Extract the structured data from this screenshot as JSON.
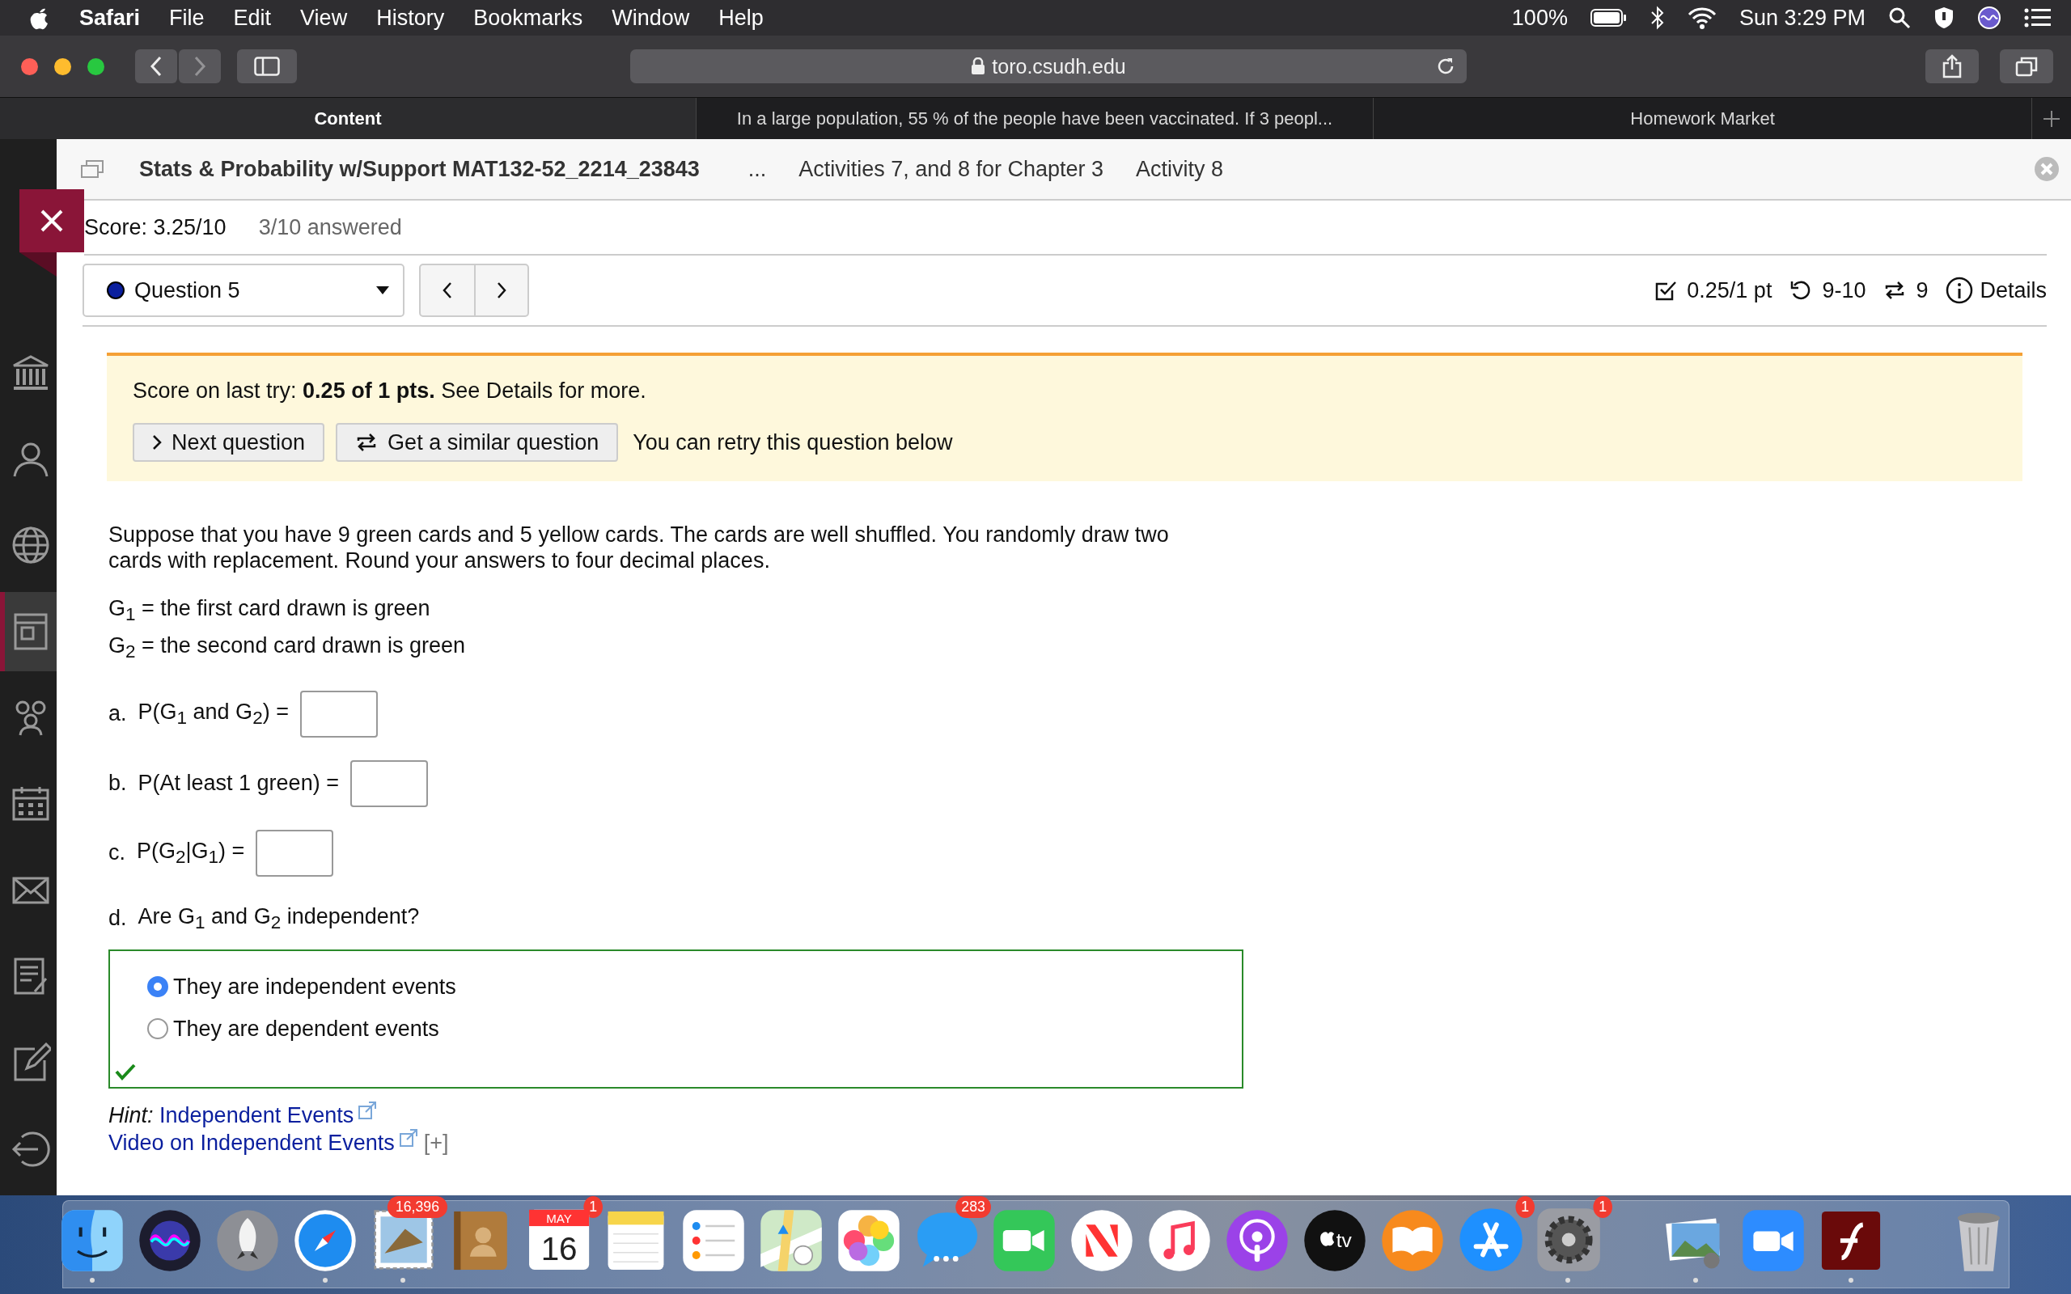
{
  "menu_bar": {
    "app": "Safari",
    "menus": [
      "File",
      "Edit",
      "View",
      "History",
      "Bookmarks",
      "Window",
      "Help"
    ],
    "battery": "100%",
    "clock": "Sun 3:29 PM"
  },
  "toolbar": {
    "back_disabled": false,
    "forward_disabled": true,
    "address": "toro.csudh.edu"
  },
  "tabs": [
    {
      "label": "Content",
      "selected": true
    },
    {
      "label": "In a large population, 55 % of the people have been vaccinated. If 3 peopl...",
      "selected": false
    },
    {
      "label": "Homework Market",
      "selected": false
    }
  ],
  "sidebar": {
    "items": [
      {
        "kind": "bank",
        "selected": false
      },
      {
        "kind": "person",
        "selected": false
      },
      {
        "kind": "globe",
        "selected": false
      },
      {
        "kind": "board",
        "selected": true
      },
      {
        "kind": "group",
        "selected": false
      },
      {
        "kind": "calendar",
        "selected": false
      },
      {
        "kind": "mail",
        "selected": false
      },
      {
        "kind": "list",
        "selected": false
      },
      {
        "kind": "edit",
        "selected": false
      },
      {
        "kind": "logout",
        "selected": false
      }
    ]
  },
  "breadcrumb": {
    "course": "Stats & Probability w/Support MAT132-52_2214_23843",
    "ellipsis": "...",
    "items": [
      "Activities 7, and 8 for Chapter 3",
      "Activity 8"
    ]
  },
  "score": {
    "total": "Score: 3.25/10",
    "answered": "3/10 answered"
  },
  "question_nav": {
    "question": "Question 5",
    "points": "0.25/1 pt",
    "attempts": "9-10",
    "versions": "9",
    "details": "Details"
  },
  "notice": {
    "text": "Score on last try: **0.25 of 1 pts.** See Details for more.",
    "buttons": [
      {
        "kind": "next",
        "label": "Next question"
      },
      {
        "kind": "similar",
        "label": "Get a similar question"
      }
    ],
    "retry": "You can retry this question below"
  },
  "question": {
    "text": "Suppose that you have 9 green cards and 5 yellow cards. The cards are well shuffled. You randomly draw two cards with replacement. Round your answers to four decimal places.",
    "definitions": [
      "G$_{1}$ = the first card drawn is green",
      "G$_{2}$ = the second card drawn is green"
    ],
    "parts": [
      {
        "kind": "input",
        "letter": "a.",
        "prompt": "P(G$_{1}$ and G$_{2}$) ="
      },
      {
        "kind": "input",
        "letter": "b.",
        "prompt": "P(At least 1 green) ="
      },
      {
        "kind": "input",
        "letter": "c.",
        "prompt": "P(G$_{2}$|G$_{1}$) ="
      },
      {
        "kind": "choice",
        "letter": "d.",
        "prompt": "Are G$_{1}$ and G$_{2}$ independent?",
        "correct": true,
        "options": [
          {
            "label": "They are independent events",
            "selected": true
          },
          {
            "label": "They are dependent events",
            "selected": false
          }
        ]
      }
    ]
  },
  "hint": {
    "label": "Hint:",
    "link": "Independent Events",
    "video": "Video on Independent Events",
    "expand": "[+]"
  },
  "dock": [
    {
      "kind": "finder",
      "running": true
    },
    {
      "kind": "siri",
      "running": false
    },
    {
      "kind": "launchpad",
      "running": false
    },
    {
      "kind": "safari",
      "running": true
    },
    {
      "kind": "mail",
      "running": true,
      "badge": "16,396"
    },
    {
      "kind": "contacts",
      "running": false
    },
    {
      "kind": "calendar",
      "running": false,
      "badge": "1",
      "month": "MAY",
      "day": "16"
    },
    {
      "kind": "notes",
      "running": false
    },
    {
      "kind": "reminders",
      "running": false
    },
    {
      "kind": "maps",
      "running": false
    },
    {
      "kind": "photos",
      "running": false
    },
    {
      "kind": "messages",
      "running": false,
      "badge": "283"
    },
    {
      "kind": "facetime",
      "running": false
    },
    {
      "kind": "news",
      "running": false
    },
    {
      "kind": "music",
      "running": false
    },
    {
      "kind": "podcasts",
      "running": false
    },
    {
      "kind": "tv",
      "running": false,
      "label": "tv"
    },
    {
      "kind": "books",
      "running": false
    },
    {
      "kind": "appstore",
      "running": false,
      "badge": "1"
    },
    {
      "kind": "preferences",
      "running": true,
      "badge": "1"
    },
    {
      "kind": "separator"
    },
    {
      "kind": "preview",
      "running": true
    },
    {
      "kind": "zoom",
      "running": false
    },
    {
      "kind": "flash",
      "running": true
    },
    {
      "kind": "separator"
    },
    {
      "kind": "trash",
      "running": false
    }
  ]
}
